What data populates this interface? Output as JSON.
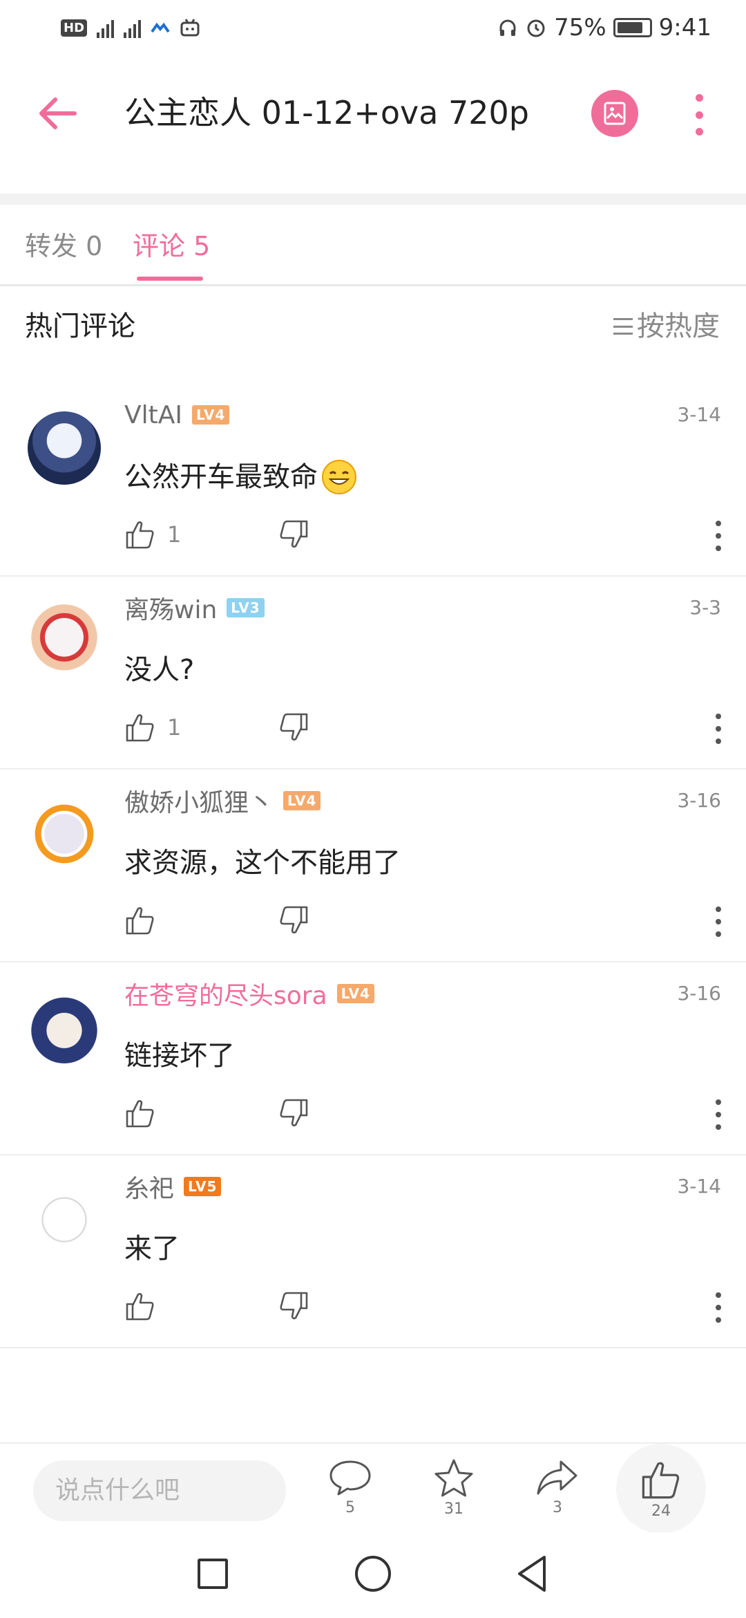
{
  "status_bar": {
    "battery": "75%",
    "time": "9:41",
    "network": "4G"
  },
  "header": {
    "title": "公主恋人 01-12+ova 720p"
  },
  "tabs": [
    {
      "label": "转发 0"
    },
    {
      "label": "评论 5"
    }
  ],
  "section": {
    "title": "热门评论",
    "sort_label": "按热度"
  },
  "comments": [
    {
      "user": "VltAI",
      "level": "LV4",
      "level_color": "#f5a96b",
      "date": "3-14",
      "text": "公然开车最致命",
      "likes": "1",
      "has_emoji": true,
      "vip": false
    },
    {
      "user": "离殇win",
      "level": "LV3",
      "level_color": "#8fd1f0",
      "date": "3-3",
      "text": "没人?",
      "likes": "1",
      "has_emoji": false,
      "vip": false
    },
    {
      "user": "傲娇小狐狸丶",
      "level": "LV4",
      "level_color": "#f5a96b",
      "date": "3-16",
      "text": "求资源，这个不能用了",
      "likes": "",
      "has_emoji": false,
      "vip": false
    },
    {
      "user": "在苍穹的尽头sora",
      "level": "LV4",
      "level_color": "#f5a96b",
      "date": "3-16",
      "text": "链接坏了",
      "likes": "",
      "has_emoji": false,
      "vip": true
    },
    {
      "user": "糸祀",
      "level": "LV5",
      "level_color": "#f07b1f",
      "date": "3-14",
      "text": "来了",
      "likes": "",
      "has_emoji": false,
      "vip": false
    }
  ],
  "bottom_bar": {
    "input_placeholder": "说点什么吧",
    "comment_count": "5",
    "favorite_count": "31",
    "share_count": "3",
    "like_count": "24"
  },
  "colors": {
    "accent": "#f06d9a",
    "text": "#212121",
    "muted": "#8a8a8a"
  }
}
